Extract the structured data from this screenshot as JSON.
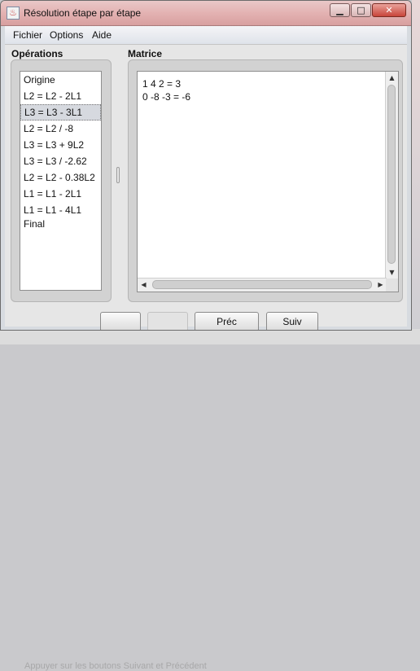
{
  "window": {
    "title": "Résolution étape par étape"
  },
  "title_buttons": {
    "minimize": "▁",
    "maximize": "□",
    "close": "✕"
  },
  "menu": {
    "items": [
      "Fichier",
      "Options",
      "Aide"
    ]
  },
  "operations": {
    "label": "Opérations",
    "items": [
      "Origine",
      "L2 = L2 - 2L1",
      "L3 = L3 - 3L1",
      "L2 = L2 / -8",
      "L3 = L3 + 9L2",
      "L3 = L3 / -2.62",
      "L2 = L2 - 0.38L2",
      "L1 = L1 - 2L1",
      "L1 = L1 - 4L1",
      "Final"
    ],
    "selected_index": 2
  },
  "matrix": {
    "label": "Matrice",
    "lines": [
      "1 4 2 = 3",
      "0 -8 -3 = -6"
    ]
  },
  "buttons": {
    "prev": "Préc",
    "next": "Suiv"
  },
  "background_text": "Appuyer sur les boutons Suivant et Précédent"
}
